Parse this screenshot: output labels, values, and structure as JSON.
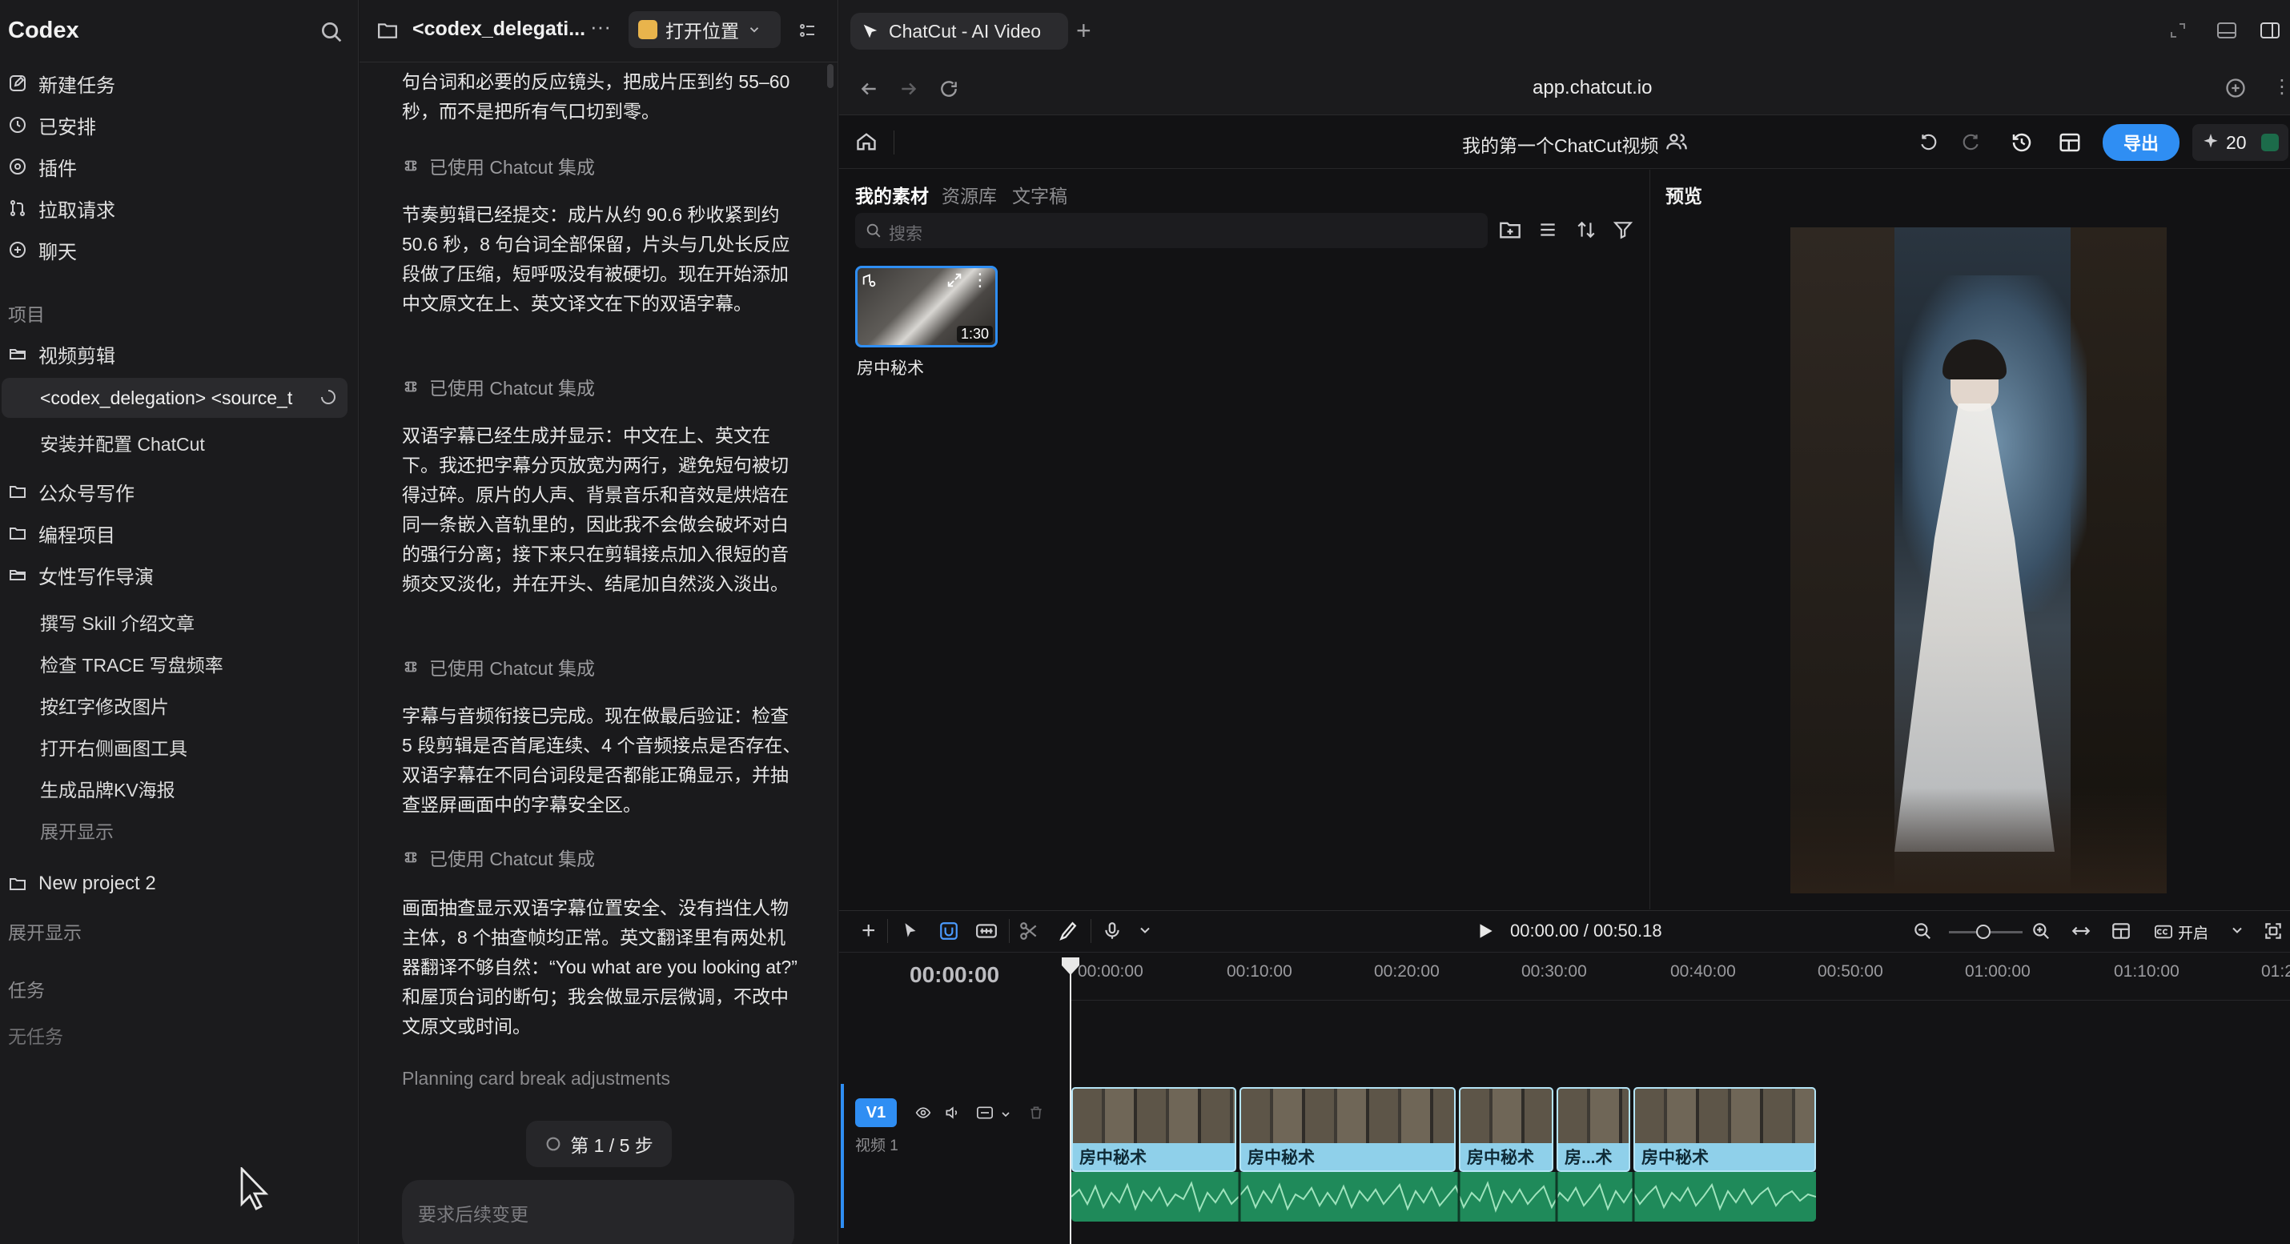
{
  "sidebar": {
    "brand": "Codex",
    "nav": [
      {
        "label": "新建任务",
        "icon": "edit-icon"
      },
      {
        "label": "已安排",
        "icon": "clock-icon"
      },
      {
        "label": "插件",
        "icon": "plugin-icon"
      },
      {
        "label": "拉取请求",
        "icon": "pull-request-icon"
      },
      {
        "label": "聊天",
        "icon": "chat-icon"
      }
    ],
    "projects_label": "项目",
    "projects": [
      {
        "label": "视频剪辑",
        "threads": [
          "<codex_delegation> <source_t",
          "安装并配置 ChatCut"
        ]
      },
      {
        "label": "公众号写作",
        "threads": []
      },
      {
        "label": "编程项目",
        "threads": []
      },
      {
        "label": "女性写作导演",
        "threads": [
          "撰写 Skill 介绍文章",
          "检查 TRACE 写盘频率",
          "按红字修改图片",
          "打开右侧画图工具",
          "生成品牌KV海报"
        ],
        "expand": "展开显示"
      },
      {
        "label": "New project 2",
        "threads": []
      }
    ],
    "expand_more": "展开显示",
    "tasks_label": "任务",
    "no_tasks": "无任务"
  },
  "conversation": {
    "tab_title": "<codex_delegati...",
    "open_location": "打开位置",
    "intro": "句台词和必要的反应镜头，把成片压到约 55–60 秒，而不是把所有气口切到零。",
    "tool_label": "已使用 Chatcut 集成",
    "paragraphs": [
      "节奏剪辑已经提交：成片从约 90.6 秒收紧到约 50.6 秒，8 句台词全部保留，片头与几处长反应段做了压缩，短呼吸没有被硬切。现在开始添加中文原文在上、英文译文在下的双语字幕。",
      "双语字幕已经生成并显示：中文在上、英文在下。我还把字幕分页放宽为两行，避免短句被切得过碎。原片的人声、背景音乐和音效是烘焙在同一条嵌入音轨里的，因此我不会做会破坏对白的强行分离；接下来只在剪辑接点加入很短的音频交叉淡化，并在开头、结尾加自然淡入淡出。",
      "字幕与音频衔接已完成。现在做最后验证：检查 5 段剪辑是否首尾连续、4 个音频接点是否存在、双语字幕在不同台词段是否都能正确显示，并抽查竖屏画面中的字幕安全区。",
      "画面抽查显示双语字幕位置安全、没有挡住人物主体，8 个抽查帧均正常。英文翻译里有两处机器翻译不够自然：“You what are you looking at?” 和屋顶台词的断句；我会做显示层微调，不改中文原文或时间。"
    ],
    "planning": "Planning card break adjustments",
    "step": "第 1 / 5 步",
    "input_placeholder": "要求后续变更"
  },
  "browser": {
    "tab_title": "ChatCut - AI Video",
    "url": "app.chatcut.io"
  },
  "app": {
    "project_name": "我的第一个ChatCut视频",
    "export_label": "导出",
    "credits": "20",
    "media_tabs": [
      "我的素材",
      "资源库",
      "文字稿"
    ],
    "search_placeholder": "搜索",
    "asset": {
      "name": "房中秘术",
      "duration": "1:30"
    },
    "preview_label": "预览",
    "timecode_display": "00:00:00",
    "play_time": "00:00.00 / 00:50.18",
    "ticks": [
      "00:00:00",
      "00:10:00",
      "00:20:00",
      "00:30:00",
      "00:40:00",
      "00:50:00",
      "01:00:00",
      "01:10:00",
      "01:2"
    ],
    "track_badge": "V1",
    "track_label": "视频 1",
    "captions_toggle": "开启",
    "clips": [
      "房中秘术",
      "房中秘术",
      "房中秘术",
      "房...术",
      "房中秘术"
    ]
  },
  "colors": {
    "accent": "#2f8ef3",
    "clip_fill": "#8fd0ea",
    "audio_fill": "#1f8a5a"
  }
}
